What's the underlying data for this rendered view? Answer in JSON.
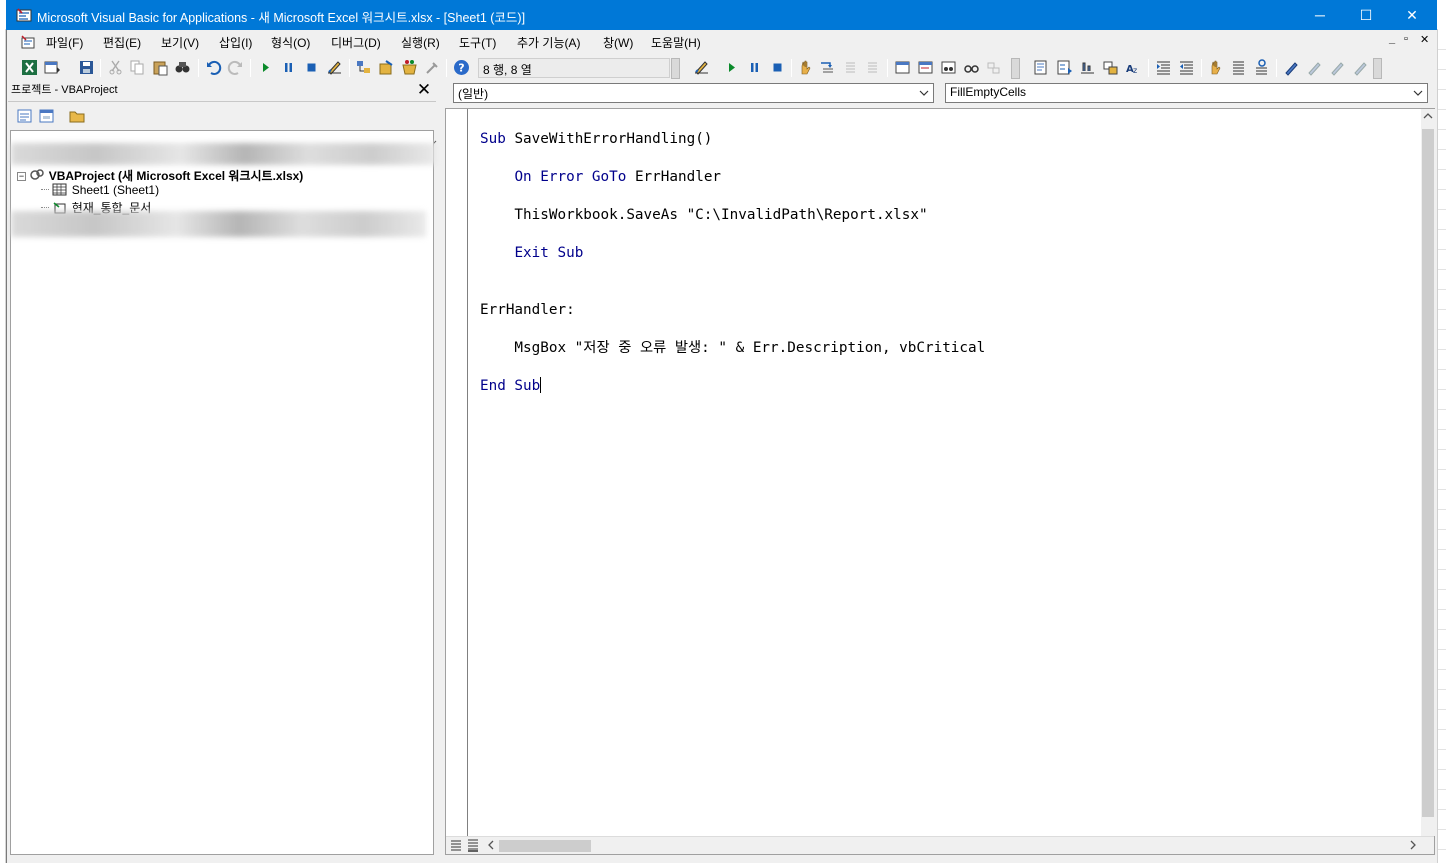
{
  "window": {
    "title": "Microsoft Visual Basic for Applications - 새 Microsoft Excel 워크시트.xlsx - [Sheet1 (코드)]",
    "minimize": "─",
    "maximize": "☐",
    "close": "✕"
  },
  "menu": {
    "items": [
      "파일(F)",
      "편집(E)",
      "보기(V)",
      "삽입(I)",
      "형식(O)",
      "디버그(D)",
      "실행(R)",
      "도구(T)",
      "추가 기능(A)",
      "창(W)",
      "도움말(H)"
    ],
    "mdi_min": "_",
    "mdi_restore": "▫",
    "mdi_close": "✕"
  },
  "toolbar": {
    "cursor_position": "8 행, 8 열"
  },
  "project": {
    "title": "프로젝트 - VBAProject",
    "close": "✕",
    "tree": {
      "root": "VBAProject (새 Microsoft Excel 워크시트.xlsx)",
      "sheet": "Sheet1 (Sheet1)",
      "workbook": "현재_통합_문서"
    }
  },
  "code": {
    "object_combo": "(일반)",
    "procedure_combo": "FillEmptyCells",
    "lines": [
      "Sub SaveWithErrorHandling()",
      "    On Error GoTo ErrHandler",
      "    ThisWorkbook.SaveAs \"C:\\InvalidPath\\Report.xlsx\"",
      "    Exit Sub",
      "",
      "ErrHandler:",
      "    MsgBox \"저장 중 오류 발생: \" & Err.Description, vbCritical",
      "End Sub"
    ]
  },
  "colors": {
    "titlebar": "#0078d7",
    "keyword": "#00008b",
    "chrome": "#f0f0f0"
  }
}
